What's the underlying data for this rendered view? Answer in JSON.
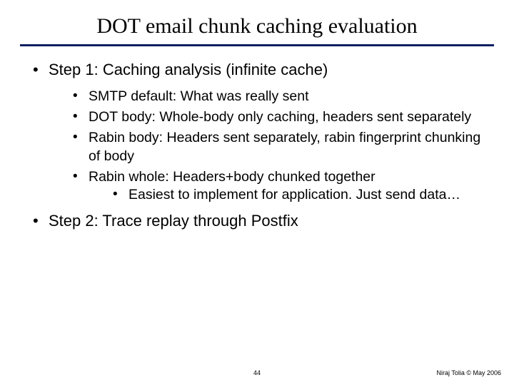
{
  "title": "DOT email chunk caching evaluation",
  "bullets": {
    "step1": {
      "label": "Step 1:  Caching analysis (infinite cache)",
      "items": {
        "smtp": "SMTP default:  What was really sent",
        "dotbody": "DOT body:  Whole-body only caching, headers sent separately",
        "rabinbody": "Rabin body:  Headers sent separately, rabin fingerprint chunking of body",
        "rabinwhole": "Rabin whole:  Headers+body chunked together",
        "rabinwhole_sub": "Easiest to implement for application.  Just send data…"
      }
    },
    "step2": {
      "label": "Step 2:  Trace replay through Postfix"
    }
  },
  "page_number": "44",
  "footer": "Niraj Tolia  © May 2006"
}
